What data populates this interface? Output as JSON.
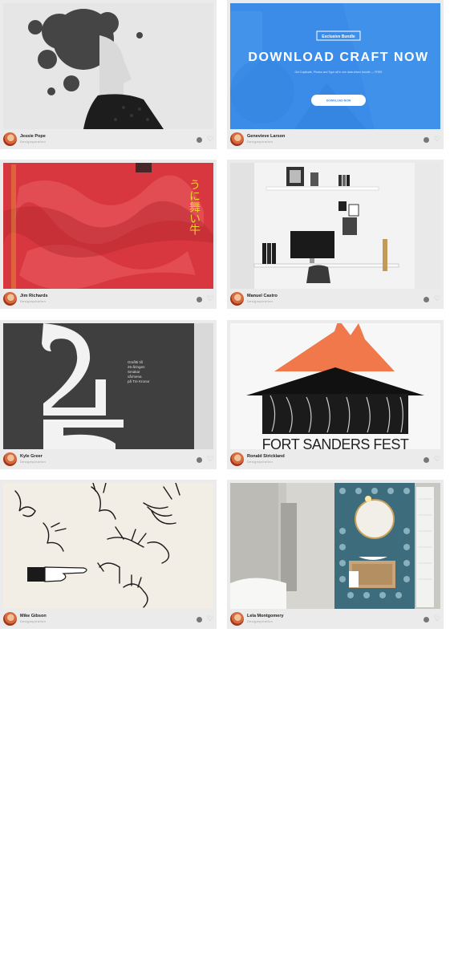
{
  "shots": [
    {
      "author": "Jessie Pope",
      "source": "Designspiration",
      "art": "ink-portrait"
    },
    {
      "author": "Genevieve Larson",
      "source": "Designspiration",
      "art": "craft-banner",
      "banner": {
        "badge": "Exclusive Bundle",
        "headline": "DOWNLOAD CRAFT NOW",
        "subtext": "Get Duplicate, Photos and Type all in one data driven bundle — FREE",
        "button": "DOWNLOAD NOW"
      }
    },
    {
      "author": "Jim Richards",
      "source": "Designspiration",
      "art": "red-poster",
      "poster": {
        "glyphs": "うに舞い牛"
      }
    },
    {
      "author": "Manuel Castro",
      "source": "Designspiration",
      "art": "office-desk"
    },
    {
      "author": "Kyle Greer",
      "source": "Designspiration",
      "art": "number-25",
      "poster": {
        "lines": [
          "Grafitti till",
          "25-åringen",
          "Smakar",
          "vårmena",
          "på Tre Kronor"
        ]
      }
    },
    {
      "author": "Ronald Strickland",
      "source": "Designspiration",
      "art": "fort-sanders",
      "poster": {
        "title": "FORT SANDERS FEST"
      }
    },
    {
      "author": "Mike Gibson",
      "source": "Designspiration",
      "art": "hands-sketch"
    },
    {
      "author": "Lela Montgomery",
      "source": "Designspiration",
      "art": "bathroom"
    }
  ],
  "colors": {
    "card_bg": "#ebebeb",
    "dot": "#777777",
    "heart": "#b5b5b5",
    "craft_blue": "#3a8ce8",
    "poster_red": "#d9373f",
    "poster_yellow": "#f0d230",
    "dark_gray": "#3f3f3f",
    "orange_roof": "#f0784a"
  },
  "icons": {
    "like": "heart-outline-icon",
    "status": "dot-icon"
  }
}
